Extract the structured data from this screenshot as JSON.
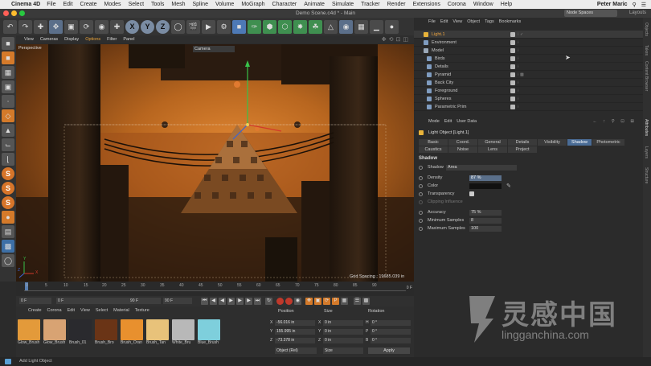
{
  "menubar": {
    "app": "Cinema 4D",
    "items": [
      "File",
      "Edit",
      "Create",
      "Modes",
      "Select",
      "Tools",
      "Mesh",
      "Spline",
      "Volume",
      "MoGraph",
      "Character",
      "Animate",
      "Simulate",
      "Tracker",
      "Render",
      "Extensions",
      "Corona",
      "Window",
      "Help"
    ],
    "user": "Peter Maric"
  },
  "window": {
    "title": "Demo Scene.c4d * - Main",
    "layout_select": "Node Spaces",
    "layouts_label": "Layouts"
  },
  "toolbar": {
    "axis_x": "X",
    "axis_y": "Y",
    "axis_z": "Z"
  },
  "viewport": {
    "menu": [
      "View",
      "Cameras",
      "Display",
      "Options",
      "Filter",
      "Panel"
    ],
    "label": "Perspective",
    "camera_select": "Camera",
    "grid_spacing": "Grid Spacing : 19685.039 in",
    "axis_y": "Y",
    "axis_z": "Z",
    "axis_x": "X"
  },
  "timeline": {
    "ticks": [
      "0",
      "5",
      "10",
      "15",
      "20",
      "25",
      "30",
      "35",
      "40",
      "45",
      "50",
      "55",
      "60",
      "65",
      "70",
      "75",
      "80",
      "85",
      "90"
    ],
    "frame_end_label": "0 F",
    "start_field": "0 F",
    "current_field": "0 F",
    "end_field": "90 F",
    "end_field2": "90 F"
  },
  "materials": {
    "menu": [
      "Create",
      "Corona",
      "Edit",
      "View",
      "Select",
      "Material",
      "Texture"
    ],
    "items": [
      {
        "name": "Glow_Brush",
        "color": "#e39a3a"
      },
      {
        "name": "Glow_Brush",
        "color": "#d8a373"
      },
      {
        "name": "Brush_01",
        "color": "#2a2a2e"
      },
      {
        "name": "Brush_Bro",
        "color": "#6a3416"
      },
      {
        "name": "Brush_Oran",
        "color": "#e8902e"
      },
      {
        "name": "Brush_Tan",
        "color": "#e8c27a"
      },
      {
        "name": "White_Bru",
        "color": "#b8b8b8"
      },
      {
        "name": "Blue_Brush",
        "color": "#7ecfdc"
      }
    ]
  },
  "coordinates": {
    "headers": {
      "position": "Position",
      "size": "Size",
      "rotation": "Rotation"
    },
    "rows": [
      {
        "axis": "X",
        "pos": "-56.016 in",
        "size_axis": "X",
        "size": "0 in",
        "rot_axis": "H",
        "rot": "0 °"
      },
      {
        "axis": "Y",
        "pos": "155.995 in",
        "size_axis": "Y",
        "size": "0 in",
        "rot_axis": "P",
        "rot": "0 °"
      },
      {
        "axis": "Z",
        "pos": "-73.378 in",
        "size_axis": "Z",
        "size": "0 in",
        "rot_axis": "B",
        "rot": "0 °"
      }
    ],
    "mode_select": "Object (Rel)",
    "size_select": "Size",
    "apply_label": "Apply"
  },
  "status": {
    "text": "Add Light Object"
  },
  "objects": {
    "menu": [
      "File",
      "Edit",
      "View",
      "Object",
      "Tags",
      "Bookmarks"
    ],
    "items": [
      {
        "name": "Light.1",
        "selected": true
      },
      {
        "name": "Environment",
        "selected": false
      },
      {
        "name": "Model",
        "selected": false
      },
      {
        "name": "Birds",
        "selected": false
      },
      {
        "name": "Details",
        "selected": false
      },
      {
        "name": "Pyramid",
        "selected": false
      },
      {
        "name": "Back City",
        "selected": false
      },
      {
        "name": "Foreground",
        "selected": false
      },
      {
        "name": "Spheres",
        "selected": false
      },
      {
        "name": "Parametric Prim",
        "selected": false
      }
    ]
  },
  "attributes": {
    "menu": [
      "Mode",
      "Edit",
      "User Data"
    ],
    "title": "Light Object [Light.1]",
    "tabs_row1": [
      "Basic",
      "Coord.",
      "General",
      "Details",
      "Visibility",
      "Shadow",
      "Photometric"
    ],
    "tabs_row2": [
      "Caustics",
      "Noise",
      "Lens",
      "Project"
    ],
    "active_tab": "Shadow",
    "section": "Shadow",
    "shadow_label": "Shadow",
    "shadow_value": "Area",
    "density_label": "Density",
    "density_value": "87 %",
    "color_label": "Color",
    "transparency_label": "Transparency",
    "clipping_label": "Clipping Influence",
    "accuracy_label": "Accuracy",
    "accuracy_value": "75 %",
    "min_samples_label": "Minimum Samples",
    "min_samples_value": "8",
    "max_samples_label": "Maximum Samples",
    "max_samples_value": "100"
  },
  "right_sidebar": {
    "tabs": [
      "Objects",
      "Takes",
      "Content Browser",
      "Attributes",
      "Layers",
      "Structure"
    ]
  },
  "watermark": {
    "title": "灵感中国",
    "url": "lingganchina.com"
  }
}
